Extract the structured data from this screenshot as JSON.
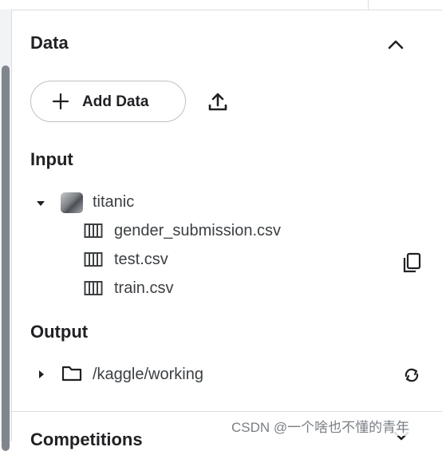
{
  "panel": {
    "title": "Data",
    "add_data_label": "Add Data",
    "input_heading": "Input",
    "output_heading": "Output",
    "next_section_heading": "Competitions"
  },
  "input": {
    "dataset": {
      "name": "titanic",
      "files": [
        {
          "name": "gender_submission.csv"
        },
        {
          "name": "test.csv"
        },
        {
          "name": "train.csv"
        }
      ]
    }
  },
  "output": {
    "folder": "/kaggle/working"
  },
  "watermark": "CSDN @一个啥也不懂的青年",
  "colors": {
    "text": "#202124",
    "secondary_text": "#3c4043",
    "border": "#dadce0",
    "scrollbar": "#80868b"
  },
  "icons": {
    "collapse": "chevron-up-icon",
    "add": "plus-icon",
    "upload": "upload-icon",
    "expand": "caret-down-icon",
    "collapsed": "caret-right-icon",
    "file": "table-file-icon",
    "copy": "copy-icon",
    "folder": "folder-icon",
    "refresh": "refresh-icon"
  }
}
